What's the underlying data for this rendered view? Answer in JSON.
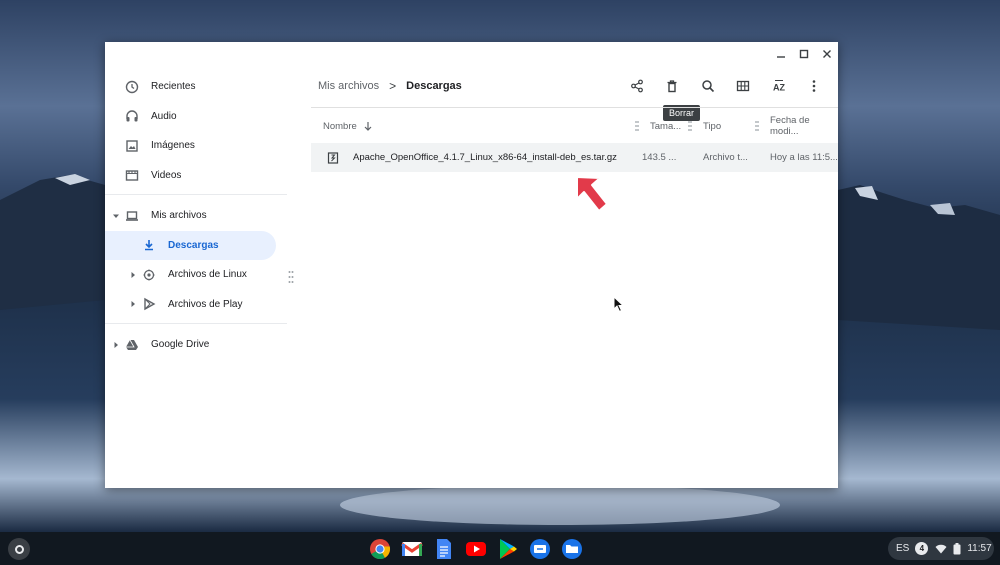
{
  "window_controls": [
    "minimize-icon",
    "maximize-icon",
    "close-icon"
  ],
  "sidebar": {
    "items": [
      {
        "label": "Recientes",
        "icon": "clock-icon"
      },
      {
        "label": "Audio",
        "icon": "headphones-icon"
      },
      {
        "label": "Imágenes",
        "icon": "image-icon"
      },
      {
        "label": "Videos",
        "icon": "video-icon"
      },
      {
        "label": "Mis archivos",
        "icon": "laptop-icon",
        "expanded": true
      },
      {
        "label": "Descargas",
        "icon": "download-icon",
        "selected": true
      },
      {
        "label": "Archivos de Linux",
        "icon": "linux-icon"
      },
      {
        "label": "Archivos de Play",
        "icon": "play-store-icon"
      },
      {
        "label": "Google Drive",
        "icon": "drive-icon"
      }
    ]
  },
  "breadcrumb": {
    "parent": "Mis archivos",
    "separator": ">",
    "current": "Descargas"
  },
  "toolbar": {
    "buttons": [
      "share-icon",
      "delete-icon",
      "search-icon",
      "grid-view-icon",
      "sort-icon",
      "more-icon"
    ],
    "tooltip": "Borrar"
  },
  "table": {
    "headers": {
      "name": "Nombre",
      "size": "Tama...",
      "type": "Tipo",
      "date": "Fecha de modi..."
    },
    "rows": [
      {
        "icon": "archive-file-icon",
        "name": "Apache_OpenOffice_4.1.7_Linux_x86-64_install-deb_es.tar.gz",
        "size": "143.5 ...",
        "type": "Archivo t...",
        "date": "Hoy a las 11:5..."
      }
    ]
  },
  "taskbar": {
    "apps": [
      "chrome-icon",
      "gmail-icon",
      "docs-icon",
      "youtube-icon",
      "play-store-icon",
      "remote-desktop-icon",
      "files-icon"
    ],
    "tray": {
      "language": "ES",
      "notifications": "4",
      "time": "11:57"
    }
  },
  "colors": {
    "accent": "#1967d2",
    "selected_bg": "#e8f0fe",
    "arrow": "#e23a4a"
  }
}
